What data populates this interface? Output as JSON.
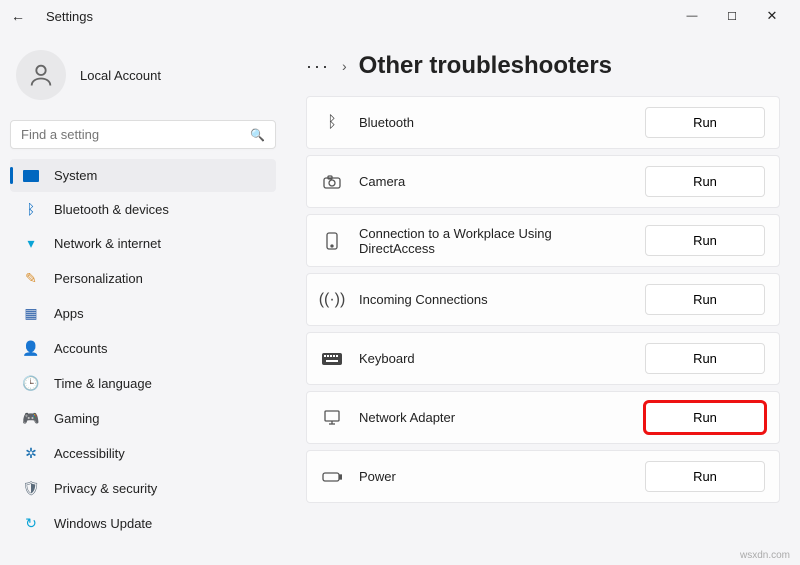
{
  "window": {
    "title": "Settings"
  },
  "account": {
    "name": "Local Account"
  },
  "search": {
    "placeholder": "Find a setting"
  },
  "nav": [
    {
      "key": "system",
      "label": "System",
      "icon_color": "#0067c0",
      "selected": true
    },
    {
      "key": "bluetooth",
      "label": "Bluetooth & devices",
      "icon_color": "#0067c0"
    },
    {
      "key": "network",
      "label": "Network & internet",
      "icon_color": "#0aa3d6"
    },
    {
      "key": "personalization",
      "label": "Personalization",
      "icon_color": "#d98f2f"
    },
    {
      "key": "apps",
      "label": "Apps",
      "icon_color": "#2b5fa8"
    },
    {
      "key": "accounts",
      "label": "Accounts",
      "icon_color": "#2e8b57"
    },
    {
      "key": "time",
      "label": "Time & language",
      "icon_color": "#555"
    },
    {
      "key": "gaming",
      "label": "Gaming",
      "icon_color": "#666"
    },
    {
      "key": "accessibility",
      "label": "Accessibility",
      "icon_color": "#1a6fb0"
    },
    {
      "key": "privacy",
      "label": "Privacy & security",
      "icon_color": "#5a6b7a"
    },
    {
      "key": "windowsupdate",
      "label": "Windows Update",
      "icon_color": "#0aa3d6"
    }
  ],
  "breadcrumb": {
    "ellipsis": "···",
    "separator": "›",
    "title": "Other troubleshooters"
  },
  "troubleshooters": [
    {
      "key": "bluetooth",
      "label": "Bluetooth",
      "run": "Run"
    },
    {
      "key": "camera",
      "label": "Camera",
      "run": "Run"
    },
    {
      "key": "directaccess",
      "label": "Connection to a Workplace Using DirectAccess",
      "run": "Run"
    },
    {
      "key": "incoming",
      "label": "Incoming Connections",
      "run": "Run"
    },
    {
      "key": "keyboard",
      "label": "Keyboard",
      "run": "Run"
    },
    {
      "key": "network-adapter",
      "label": "Network Adapter",
      "run": "Run",
      "highlight": true
    },
    {
      "key": "power",
      "label": "Power",
      "run": "Run"
    }
  ],
  "watermark": "wsxdn.com"
}
